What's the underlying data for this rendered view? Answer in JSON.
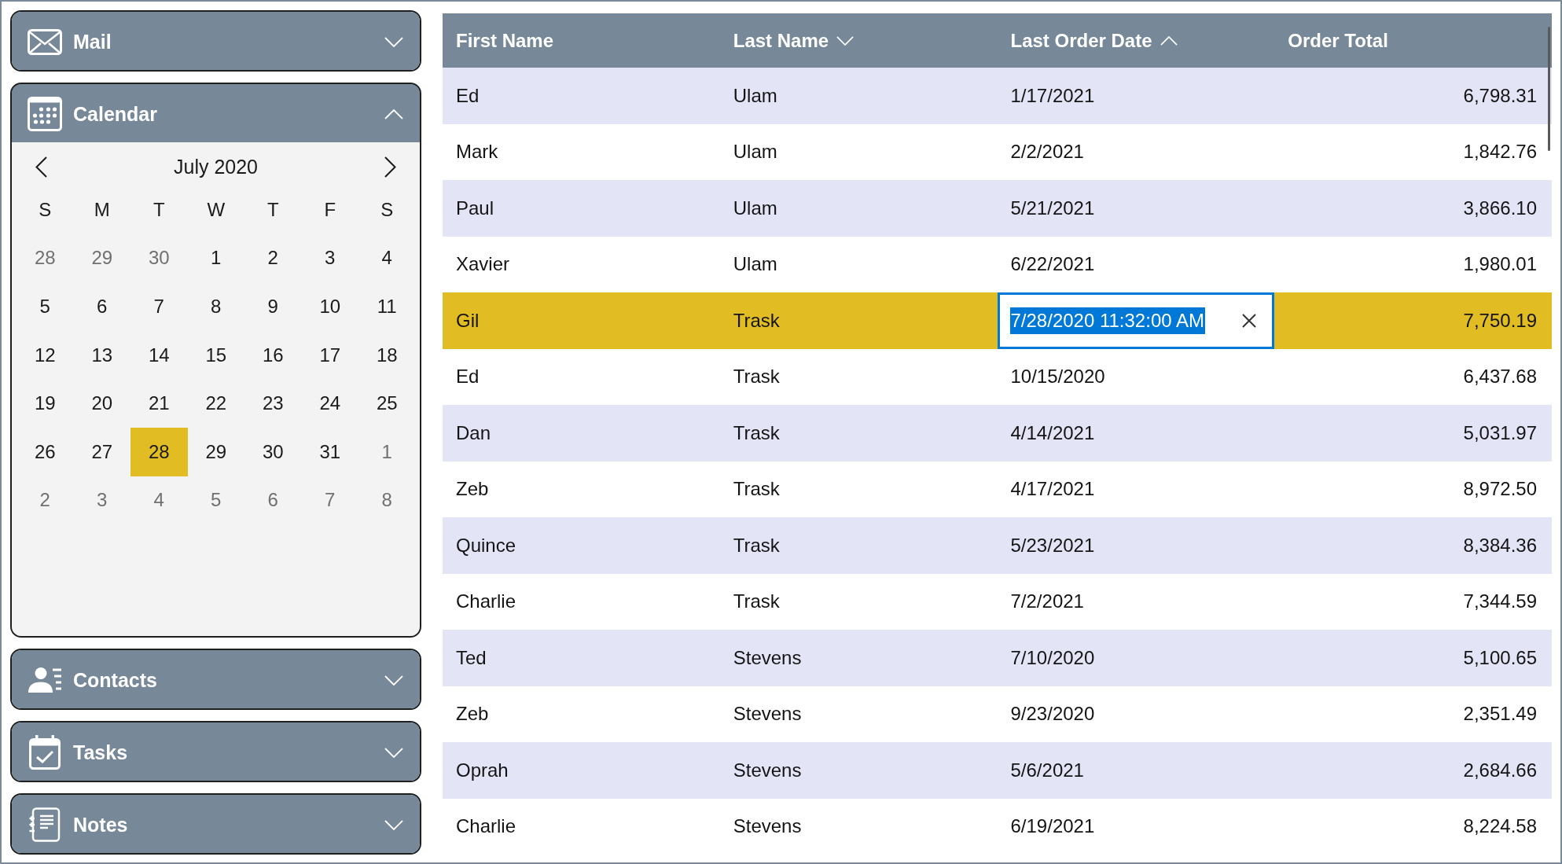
{
  "sidebar": {
    "sections": [
      {
        "kind": "mail",
        "label": "Mail",
        "expanded": false
      },
      {
        "kind": "calendar",
        "label": "Calendar",
        "expanded": true,
        "calendar": {
          "month_label": "July 2020",
          "weekdays": [
            "S",
            "M",
            "T",
            "W",
            "T",
            "F",
            "S"
          ],
          "weeks": [
            [
              {
                "day": "28",
                "in_month": false,
                "selected": false
              },
              {
                "day": "29",
                "in_month": false,
                "selected": false
              },
              {
                "day": "30",
                "in_month": false,
                "selected": false
              },
              {
                "day": "1",
                "in_month": true,
                "selected": false
              },
              {
                "day": "2",
                "in_month": true,
                "selected": false
              },
              {
                "day": "3",
                "in_month": true,
                "selected": false
              },
              {
                "day": "4",
                "in_month": true,
                "selected": false
              }
            ],
            [
              {
                "day": "5",
                "in_month": true,
                "selected": false
              },
              {
                "day": "6",
                "in_month": true,
                "selected": false
              },
              {
                "day": "7",
                "in_month": true,
                "selected": false
              },
              {
                "day": "8",
                "in_month": true,
                "selected": false
              },
              {
                "day": "9",
                "in_month": true,
                "selected": false
              },
              {
                "day": "10",
                "in_month": true,
                "selected": false
              },
              {
                "day": "11",
                "in_month": true,
                "selected": false
              }
            ],
            [
              {
                "day": "12",
                "in_month": true,
                "selected": false
              },
              {
                "day": "13",
                "in_month": true,
                "selected": false
              },
              {
                "day": "14",
                "in_month": true,
                "selected": false
              },
              {
                "day": "15",
                "in_month": true,
                "selected": false
              },
              {
                "day": "16",
                "in_month": true,
                "selected": false
              },
              {
                "day": "17",
                "in_month": true,
                "selected": false
              },
              {
                "day": "18",
                "in_month": true,
                "selected": false
              }
            ],
            [
              {
                "day": "19",
                "in_month": true,
                "selected": false
              },
              {
                "day": "20",
                "in_month": true,
                "selected": false
              },
              {
                "day": "21",
                "in_month": true,
                "selected": false
              },
              {
                "day": "22",
                "in_month": true,
                "selected": false
              },
              {
                "day": "23",
                "in_month": true,
                "selected": false
              },
              {
                "day": "24",
                "in_month": true,
                "selected": false
              },
              {
                "day": "25",
                "in_month": true,
                "selected": false
              }
            ],
            [
              {
                "day": "26",
                "in_month": true,
                "selected": false
              },
              {
                "day": "27",
                "in_month": true,
                "selected": false
              },
              {
                "day": "28",
                "in_month": true,
                "selected": true
              },
              {
                "day": "29",
                "in_month": true,
                "selected": false
              },
              {
                "day": "30",
                "in_month": true,
                "selected": false
              },
              {
                "day": "31",
                "in_month": true,
                "selected": false
              },
              {
                "day": "1",
                "in_month": false,
                "selected": false
              }
            ],
            [
              {
                "day": "2",
                "in_month": false,
                "selected": false
              },
              {
                "day": "3",
                "in_month": false,
                "selected": false
              },
              {
                "day": "4",
                "in_month": false,
                "selected": false
              },
              {
                "day": "5",
                "in_month": false,
                "selected": false
              },
              {
                "day": "6",
                "in_month": false,
                "selected": false
              },
              {
                "day": "7",
                "in_month": false,
                "selected": false
              },
              {
                "day": "8",
                "in_month": false,
                "selected": false
              }
            ]
          ]
        }
      },
      {
        "kind": "contacts",
        "label": "Contacts",
        "expanded": false
      },
      {
        "kind": "tasks",
        "label": "Tasks",
        "expanded": false
      },
      {
        "kind": "notes",
        "label": "Notes",
        "expanded": false
      }
    ]
  },
  "table": {
    "columns": [
      {
        "label": "First Name",
        "kind": "text",
        "sorted": false
      },
      {
        "label": "Last Name",
        "kind": "text",
        "sorted": true,
        "ascending": false
      },
      {
        "label": "Last Order Date",
        "kind": "text",
        "sorted": true,
        "ascending": true
      },
      {
        "label": "Order Total",
        "kind": "number",
        "sorted": false
      }
    ],
    "rows": [
      {
        "selected": false,
        "cells": [
          {
            "text": "Ed",
            "editing": false
          },
          {
            "text": "Ulam",
            "editing": false
          },
          {
            "text": "1/17/2021",
            "editing": false
          },
          {
            "text": "6,798.31",
            "editing": false
          }
        ]
      },
      {
        "selected": false,
        "cells": [
          {
            "text": "Mark",
            "editing": false
          },
          {
            "text": "Ulam",
            "editing": false
          },
          {
            "text": "2/2/2021",
            "editing": false
          },
          {
            "text": "1,842.76",
            "editing": false
          }
        ]
      },
      {
        "selected": false,
        "cells": [
          {
            "text": "Paul",
            "editing": false
          },
          {
            "text": "Ulam",
            "editing": false
          },
          {
            "text": "5/21/2021",
            "editing": false
          },
          {
            "text": "3,866.10",
            "editing": false
          }
        ]
      },
      {
        "selected": false,
        "cells": [
          {
            "text": "Xavier",
            "editing": false
          },
          {
            "text": "Ulam",
            "editing": false
          },
          {
            "text": "6/22/2021",
            "editing": false
          },
          {
            "text": "1,980.01",
            "editing": false
          }
        ]
      },
      {
        "selected": true,
        "cells": [
          {
            "text": "Gil",
            "editing": false
          },
          {
            "text": "Trask",
            "editing": false
          },
          {
            "text": "7/28/2020 11:32:00 AM",
            "editing": true,
            "text_selected": true
          },
          {
            "text": "7,750.19",
            "editing": false
          }
        ]
      },
      {
        "selected": false,
        "cells": [
          {
            "text": "Ed",
            "editing": false
          },
          {
            "text": "Trask",
            "editing": false
          },
          {
            "text": "10/15/2020",
            "editing": false
          },
          {
            "text": "6,437.68",
            "editing": false
          }
        ]
      },
      {
        "selected": false,
        "cells": [
          {
            "text": "Dan",
            "editing": false
          },
          {
            "text": "Trask",
            "editing": false
          },
          {
            "text": "4/14/2021",
            "editing": false
          },
          {
            "text": "5,031.97",
            "editing": false
          }
        ]
      },
      {
        "selected": false,
        "cells": [
          {
            "text": "Zeb",
            "editing": false
          },
          {
            "text": "Trask",
            "editing": false
          },
          {
            "text": "4/17/2021",
            "editing": false
          },
          {
            "text": "8,972.50",
            "editing": false
          }
        ]
      },
      {
        "selected": false,
        "cells": [
          {
            "text": "Quince",
            "editing": false
          },
          {
            "text": "Trask",
            "editing": false
          },
          {
            "text": "5/23/2021",
            "editing": false
          },
          {
            "text": "8,384.36",
            "editing": false
          }
        ]
      },
      {
        "selected": false,
        "cells": [
          {
            "text": "Charlie",
            "editing": false
          },
          {
            "text": "Trask",
            "editing": false
          },
          {
            "text": "7/2/2021",
            "editing": false
          },
          {
            "text": "7,344.59",
            "editing": false
          }
        ]
      },
      {
        "selected": false,
        "cells": [
          {
            "text": "Ted",
            "editing": false
          },
          {
            "text": "Stevens",
            "editing": false
          },
          {
            "text": "7/10/2020",
            "editing": false
          },
          {
            "text": "5,100.65",
            "editing": false
          }
        ]
      },
      {
        "selected": false,
        "cells": [
          {
            "text": "Zeb",
            "editing": false
          },
          {
            "text": "Stevens",
            "editing": false
          },
          {
            "text": "9/23/2020",
            "editing": false
          },
          {
            "text": "2,351.49",
            "editing": false
          }
        ]
      },
      {
        "selected": false,
        "cells": [
          {
            "text": "Oprah",
            "editing": false
          },
          {
            "text": "Stevens",
            "editing": false
          },
          {
            "text": "5/6/2021",
            "editing": false
          },
          {
            "text": "2,684.66",
            "editing": false
          }
        ]
      },
      {
        "selected": false,
        "cells": [
          {
            "text": "Charlie",
            "editing": false
          },
          {
            "text": "Stevens",
            "editing": false
          },
          {
            "text": "6/19/2021",
            "editing": false
          },
          {
            "text": "8,224.58",
            "editing": false
          }
        ]
      }
    ]
  }
}
